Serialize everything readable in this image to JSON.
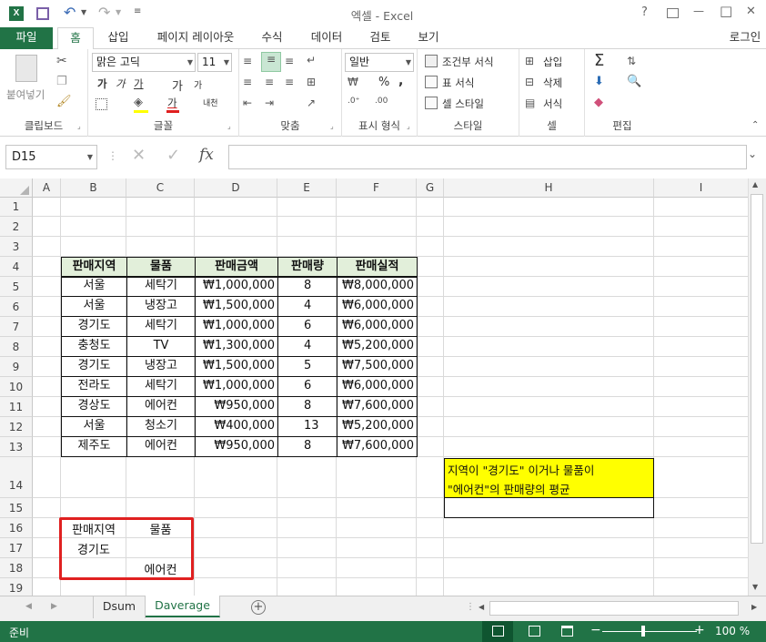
{
  "window": {
    "title": "엑셀 - Excel",
    "help": "?",
    "min": "—",
    "max": "□",
    "close": "✕"
  },
  "ribbon_tabs": [
    "파일",
    "홈",
    "삽입",
    "페이지 레이아웃",
    "수식",
    "데이터",
    "검토",
    "보기"
  ],
  "signin": "로그인",
  "ribbon": {
    "clipboard": {
      "paste": "붙여넣기",
      "label": "클립보드"
    },
    "font": {
      "name": "맑은 고딕",
      "size": "11",
      "bold": "가",
      "italic": "가",
      "underline": "가",
      "grow": "가",
      "shrink": "가",
      "fontcolor": "가",
      "phonetic": "내천",
      "label": "글꼴"
    },
    "align": {
      "label": "맞춤"
    },
    "number": {
      "format": "일반",
      "percent": "%",
      "comma": ",",
      "label": "표시 형식"
    },
    "styles": {
      "cond": "조건부 서식",
      "table": "표 서식",
      "cell": "셀 스타일",
      "label": "스타일"
    },
    "cells": {
      "insert": "삽입",
      "delete": "삭제",
      "format": "서식",
      "label": "셀"
    },
    "editing": {
      "label": "편집"
    }
  },
  "formula": {
    "namebox": "D15",
    "cancel": "✕",
    "enter": "✓",
    "fx": "fx",
    "content": ""
  },
  "columns": [
    "A",
    "B",
    "C",
    "D",
    "E",
    "F",
    "G",
    "H",
    "I"
  ],
  "rows": [
    "1",
    "2",
    "3",
    "4",
    "5",
    "6",
    "7",
    "8",
    "9",
    "10",
    "11",
    "12",
    "13",
    "14",
    "15",
    "16",
    "17",
    "18",
    "19"
  ],
  "table": {
    "headers": [
      "판매지역",
      "물품",
      "판매금액",
      "판매량",
      "판매실적"
    ],
    "rows": [
      [
        "서울",
        "세탁기",
        "₩1,000,000",
        "8",
        "₩8,000,000"
      ],
      [
        "서울",
        "냉장고",
        "₩1,500,000",
        "4",
        "₩6,000,000"
      ],
      [
        "경기도",
        "세탁기",
        "₩1,000,000",
        "6",
        "₩6,000,000"
      ],
      [
        "충청도",
        "TV",
        "₩1,300,000",
        "4",
        "₩5,200,000"
      ],
      [
        "경기도",
        "냉장고",
        "₩1,500,000",
        "5",
        "₩7,500,000"
      ],
      [
        "전라도",
        "세탁기",
        "₩1,000,000",
        "6",
        "₩6,000,000"
      ],
      [
        "경상도",
        "에어컨",
        "₩950,000",
        "8",
        "₩7,600,000"
      ],
      [
        "서울",
        "청소기",
        "₩400,000",
        "13",
        "₩5,200,000"
      ],
      [
        "제주도",
        "에어컨",
        "₩950,000",
        "8",
        "₩7,600,000"
      ]
    ]
  },
  "question": {
    "line1": "지역이 \"경기도\" 이거나 물품이",
    "line2": "\"에어컨\"의 판매량의 평균",
    "answer": ""
  },
  "criteria": {
    "h1": "판매지역",
    "h2": "물품",
    "v1": "경기도",
    "v2": "에어컨"
  },
  "sheets": [
    "Dsum",
    "Daverage"
  ],
  "active_sheet": "Daverage",
  "status": {
    "ready": "준비",
    "zoom": "100 %"
  },
  "colors": {
    "excel_green": "#217346",
    "highlight": "#ffff00",
    "header_fill": "#e2efda",
    "criteria_border": "#e02020"
  }
}
